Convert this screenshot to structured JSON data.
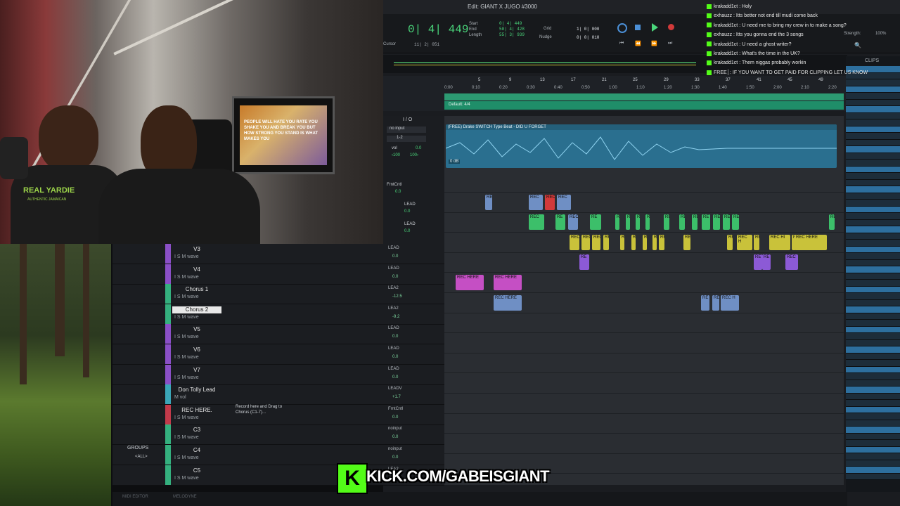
{
  "window": {
    "title": "Edit: GIANT X JUGO #3000"
  },
  "transport": {
    "main_counter": "0| 4| 449",
    "start_label": "Start",
    "end_label": "End",
    "length_label": "Length",
    "start_value": "0| 4| 449",
    "end_value": "58| 4| 428",
    "length_value": "55| 3| 939",
    "cursor_label": "Cursor",
    "cursor_value": "11| 2| 051",
    "grid_label": "Grid",
    "grid_value": "1| 0| 000",
    "nudge_label": "Nudge",
    "nudge_value": "0| 0| 010",
    "strength_label": "Strength:",
    "strength_value": "100%"
  },
  "ruler": {
    "bars": [
      "5",
      "9",
      "13",
      "17",
      "21",
      "25",
      "29",
      "33",
      "37",
      "41",
      "45",
      "49"
    ],
    "times": [
      "0:00",
      "0:10",
      "0:20",
      "0:30",
      "0:40",
      "0:50",
      "1:00",
      "1:10",
      "1:20",
      "1:30",
      "1:40",
      "1:50",
      "2:00",
      "2:10",
      "2:20"
    ],
    "meter_label": "Default: 4/4"
  },
  "io_panel": {
    "header": "I / O",
    "input_label": "no input",
    "output_label": "1-2",
    "vol_label": "vol",
    "vol_value": "0.0",
    "pan_left": "‹100",
    "pan_right": "100›"
  },
  "beat_track": {
    "clip_name": "(FREE) Drake SWITCH Type Beat - DID U FORGET",
    "clip_gain": "0 dB"
  },
  "tracks": [
    {
      "name": "V3",
      "sub": "I S M wave",
      "insert": "LEAD",
      "vol": "0.0",
      "color": "#8a4fc6",
      "selected": false
    },
    {
      "name": "V4",
      "sub": "I S M wave",
      "insert": "LEAD",
      "vol": "0.0",
      "color": "#8a4fc6",
      "selected": false
    },
    {
      "name": "Chorus 1",
      "sub": "I S M wave",
      "insert": "LEA2",
      "vol": "-12.5",
      "color": "#34b07e",
      "selected": false
    },
    {
      "name": "Chorus 2",
      "sub": "I S M wave",
      "insert": "LEA2",
      "vol": "-9.2",
      "color": "#34b07e",
      "selected": true
    },
    {
      "name": "V5",
      "sub": "I S M wave",
      "insert": "LEAD",
      "vol": "0.0",
      "color": "#8a4fc6",
      "selected": false
    },
    {
      "name": "V6",
      "sub": "I S M wave",
      "insert": "LEAD",
      "vol": "0.0",
      "color": "#8a4fc6",
      "selected": false
    },
    {
      "name": "V7",
      "sub": "I S M wave",
      "insert": "LEAD",
      "vol": "0.0",
      "color": "#8a4fc6",
      "selected": false
    },
    {
      "name": "Don Tolly Lead",
      "sub": "M vol",
      "insert": "LEADV",
      "vol": "+1.7",
      "color": "#3aa6b8",
      "selected": false
    },
    {
      "name": "REC HERE.",
      "sub": "I S M wave",
      "insert": "FrntCntl",
      "vol": "0.0",
      "color": "#c23a4a",
      "selected": false
    },
    {
      "name": "C3",
      "sub": "I S M wave",
      "insert": "noinput",
      "vol": "0.0",
      "color": "#34b07e",
      "selected": false
    },
    {
      "name": "C4",
      "sub": "I S M wave",
      "insert": "noinput",
      "vol": "0.0",
      "color": "#34b07e",
      "selected": false
    },
    {
      "name": "C5",
      "sub": "I S M wave",
      "insert": "LEA2",
      "vol": "0.0",
      "color": "#34b07e",
      "selected": false
    }
  ],
  "rec_here_comment": "Record here and Drag to Chorus (C1-7)...",
  "upper_io": [
    {
      "label": "FrntCntl",
      "vol": "0.0"
    },
    {
      "label": "LEAD",
      "vol": "0.0"
    },
    {
      "label": "LEAD",
      "vol": "0.0"
    }
  ],
  "groups_label": "GROUPS",
  "groups_all": "<ALL>",
  "clips_header": "CLIPS",
  "bottom_tabs": [
    "MIDI EDITOR",
    "MELODYNE"
  ],
  "clip_labels": {
    "rec_here": "REC HERE",
    "rec": "REC",
    "re": "RE",
    "rec_h": "REC H",
    "rec_hi": "REC HI",
    "rec_here_short": "REC HERE",
    "gain": "0 dB"
  },
  "chat": [
    {
      "user": "krakadd1ct",
      "msg": "Holy"
    },
    {
      "user": "exhauzz",
      "msg": "Itts better not end till mudi come back"
    },
    {
      "user": "krakadd1ct",
      "msg": "U need me to bring my crew in to make a song?"
    },
    {
      "user": "exhauzz",
      "msg": "Itts you gonna end the 3 songs"
    },
    {
      "user": "krakadd1ct",
      "msg": "U need a ghost writer?"
    },
    {
      "user": "krakadd1ct",
      "msg": "What's the time in the UK?"
    },
    {
      "user": "krakadd1ct",
      "msg": "Them niggas probably workin"
    },
    {
      "user": "",
      "msg": "FREE│: IF YOU WANT TO GET PAID FOR CLIPPING LET US KNOW"
    }
  ],
  "overlay": {
    "kick_url": "KICK.COM/GABEISGIANT",
    "kick_logo": "K"
  },
  "webcam": {
    "shirt_text": "REAL YARDIE",
    "shirt_sub": "AUTHENTIC JAMAICAN",
    "monitor_text": "PEOPLE WILL HATE YOU RATE YOU SHAKE YOU AND BREAK YOU BUT HOW STRONG YOU STAND IS WHAT MAKES YOU"
  },
  "colors": {
    "accent_green": "#4ad67b",
    "beat_clip": "#2a6f8f",
    "clip_green": "#3cbf6a",
    "clip_yellow": "#c9c23a",
    "clip_purple": "#8c5ad6",
    "clip_magenta": "#c54fc4",
    "clip_blue": "#6f8fc4",
    "clip_red": "#d23a3a",
    "kick_green": "#53fc18"
  }
}
